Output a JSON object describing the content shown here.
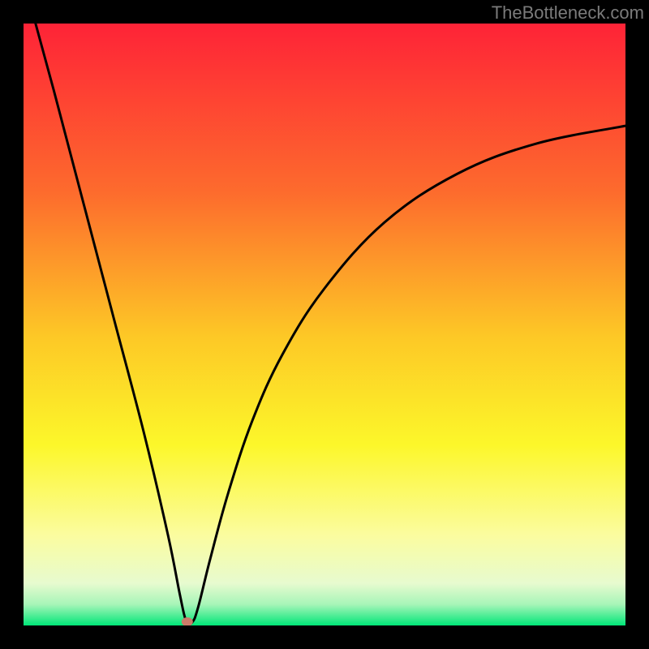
{
  "watermark": "TheBottleneck.com",
  "colors": {
    "top": "#FE2337",
    "mid_upper": "#FD7C2C",
    "mid": "#FDD924",
    "mid_lower": "#FCFC85",
    "pale": "#F3FCD7",
    "bottom": "#00E678",
    "curve": "#000000",
    "marker": "#CB7B69",
    "frame": "#000000"
  },
  "chart_data": {
    "type": "line",
    "title": "",
    "xlabel": "",
    "ylabel": "",
    "xlim": [
      0,
      100
    ],
    "ylim": [
      0,
      100
    ],
    "minimum_x": 27,
    "series": [
      {
        "name": "bottleneck-curve",
        "x": [
          2,
          5,
          10,
          15,
          20,
          24,
          26,
          27,
          28,
          29,
          31,
          34,
          38,
          43,
          50,
          60,
          72,
          85,
          100
        ],
        "y": [
          100,
          89,
          70,
          51,
          32,
          15,
          5,
          0.8,
          0.5,
          3,
          11,
          22,
          34,
          45,
          56,
          67,
          75,
          80,
          83
        ]
      }
    ],
    "marker": {
      "x": 27.2,
      "y": 0.6
    },
    "gradient_stops": [
      {
        "offset": 0.0,
        "color": "#FE2337"
      },
      {
        "offset": 0.28,
        "color": "#FD6B2D"
      },
      {
        "offset": 0.52,
        "color": "#FDC826"
      },
      {
        "offset": 0.7,
        "color": "#FCF72A"
      },
      {
        "offset": 0.85,
        "color": "#FBFC9F"
      },
      {
        "offset": 0.93,
        "color": "#E7FBCF"
      },
      {
        "offset": 0.965,
        "color": "#A7F5B8"
      },
      {
        "offset": 1.0,
        "color": "#00E678"
      }
    ]
  }
}
